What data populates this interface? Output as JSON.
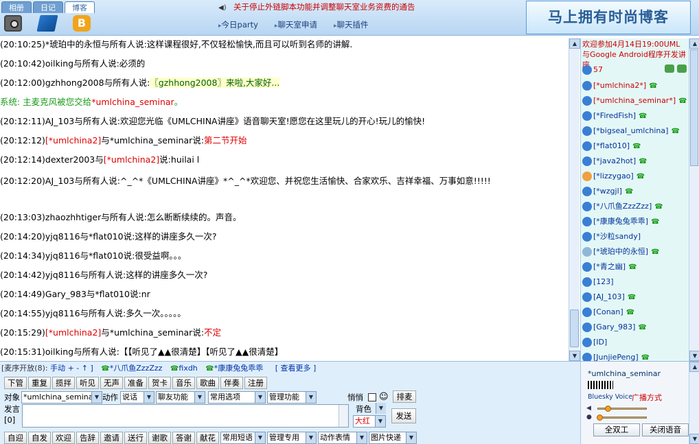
{
  "header": {
    "tabs": [
      "相册",
      "日记",
      "博客"
    ],
    "notice": "关于停止外链脚本功能并调整聊天室业务资费的通告",
    "nav": [
      "今日party",
      "聊天室申请",
      "聊天插件"
    ],
    "banner": "马上拥有时尚博客"
  },
  "chat": {
    "messages": [
      {
        "t": "(20:10:25)",
        "a": "*琥珀中的永恒",
        "mid": "与所有人说:",
        "b": "",
        "txt": "这样课程很好,不仅轻松愉快,而且可以听到名师的讲解."
      },
      {
        "t": "(20:10:42)",
        "a": "oilking",
        "mid": "与所有人说:",
        "b": "",
        "txt": "必须的"
      },
      {
        "t": "(20:12:00)",
        "a": "gzhhong2008",
        "mid": "与所有人说:",
        "b": "",
        "hl": "〖gzhhong2008〗来啦,大家好..."
      },
      {
        "sys": "系统:   主麦克风被您交给",
        "sysred": "*umlchina_seminar",
        "sysend": "。"
      },
      {
        "t": "(20:12:11)",
        "a": "AJ_103",
        "mid": "与所有人说:",
        "b": "",
        "txt": "欢迎您光临《UMLCHINA讲座》语音聊天室!愿您在这里玩儿的开心!玩儿的愉快!"
      },
      {
        "t": "(20:12:12)",
        "ared": "[*umlchina2]",
        "mid": "与",
        "b": "*umlchina_seminar",
        "mid2": "说:",
        "red": "第二节开始"
      },
      {
        "t": "(20:12:14)",
        "a": "dexter2003",
        "mid": "与",
        "bred": "[*umlchina2]",
        "mid2": "说:",
        "txt": "huilai l"
      },
      {
        "t": "(20:12:20)",
        "a": "AJ_103",
        "mid": "与所有人说:",
        "b": "",
        "txt": "^_^*《UMLCHINA讲座》*^_^*欢迎您、并祝您生活愉快、合家欢乐、吉祥幸福、万事如意!!!!!"
      },
      {
        "t": "(20:13:03)",
        "a": "zhaozhhtiger",
        "mid": "与所有人说:",
        "b": "",
        "txt": "怎么断断续续的。声音。"
      },
      {
        "t": "(20:14:20)",
        "a": "yjq8116",
        "mid": "与",
        "b": "*flat010",
        "mid2": "说:",
        "txt": "这样的讲座多久一次?"
      },
      {
        "t": "(20:14:34)",
        "a": "yjq8116",
        "mid": "与",
        "b": "*flat010",
        "mid2": "说:",
        "txt": "很受益啊。。。"
      },
      {
        "t": "(20:14:42)",
        "a": "yjq8116",
        "mid": "与所有人说:",
        "b": "",
        "txt": "这样的讲座多久一次?"
      },
      {
        "t": "(20:14:49)",
        "a": "Gary_983",
        "mid": "与",
        "b": "*flat010",
        "mid2": "说:",
        "txt": "nr"
      },
      {
        "t": "(20:14:55)",
        "a": "yjq8116",
        "mid": "与所有人说:",
        "b": "",
        "txt": "多久一次。。。。。"
      },
      {
        "t": "(20:15:29)",
        "ared": "[*umlchina2]",
        "mid": "与",
        "b": "*umlchina_seminar",
        "mid2": "说:",
        "red": "不定"
      },
      {
        "t": "(20:15:31)",
        "a": "oilking",
        "mid": "与所有人说:",
        "b": "",
        "txt": "【【听见了▲▲很清楚】【听见了▲▲很清楚】"
      }
    ]
  },
  "sidebar": {
    "welcome": "欢迎参加4月14日19:00UML与Google Android程序开发讲座",
    "online_count": "57",
    "users": [
      {
        "name": "[*umlchina2*]",
        "red": true,
        "phone": true
      },
      {
        "name": "[*umlchina_seminar*]",
        "red": true,
        "phone": true
      },
      {
        "name": "[*FiredFish]",
        "phone": true
      },
      {
        "name": "[*bigseal_umlchina]",
        "phone": true
      },
      {
        "name": "[*flat010]",
        "phone": true
      },
      {
        "name": "[*java2hot]",
        "phone": true
      },
      {
        "name": "[*lizzygao]",
        "phone": true,
        "kid": true
      },
      {
        "name": "[*wzgjl]",
        "phone": true
      },
      {
        "name": "[*八爪鱼ZzzZzz]",
        "phone": true
      },
      {
        "name": "[*康康兔兔乖乖]",
        "phone": true
      },
      {
        "name": "[*沙粒sandy]",
        "phone": false
      },
      {
        "name": "[*琥珀中的永恒]",
        "phone": true,
        "fish": true
      },
      {
        "name": "[*青之幽]",
        "phone": true
      },
      {
        "name": "[123]",
        "phone": false
      },
      {
        "name": "[AJ_103]",
        "phone": true
      },
      {
        "name": "[Conan]",
        "phone": true
      },
      {
        "name": "[Gary_983]",
        "phone": true
      },
      {
        "name": "[ID]",
        "phone": false
      },
      {
        "name": "[JunjiePeng]",
        "phone": true
      }
    ]
  },
  "mic": {
    "label": "[麦序开放(8):",
    "mode": "手动 + - ↑ ]",
    "users": [
      "*八爪鱼ZzzZzz",
      "fixdh",
      "*康康兔兔乖乖"
    ],
    "more": "[ 查看更多 ]"
  },
  "buttons_row1": [
    "下管",
    "重复",
    "揽拌",
    "听见",
    "无声",
    "准备",
    "贺卡",
    "音乐",
    "歌曲",
    "伴奏",
    "注册"
  ],
  "controls": {
    "target_label": "对象",
    "target_value": "*umlchina_semina",
    "action_label": "动作",
    "action_value": "说话",
    "friends": "聊友功能",
    "common": "常用选项",
    "manage": "管理功能",
    "quiet_label": "悄悄",
    "queue": "排麦",
    "speak_label": "发言",
    "speak_count": "[0]",
    "bg_label": "背色",
    "size_label": "大红",
    "send": "发送"
  },
  "buttons_row3": [
    "自迎",
    "自发",
    "欢迎",
    "告辞",
    "邀请",
    "送行",
    "谢歌",
    "答谢",
    "献花"
  ],
  "selects_row3": [
    "常用短语",
    "管理专用",
    "动作表情",
    "图片快递"
  ],
  "voice": {
    "user": "*umlchina_seminar",
    "brand": "Bluesky Voice",
    "mode": "广播方式",
    "duplex": "全双工",
    "close": "关闭语音"
  }
}
